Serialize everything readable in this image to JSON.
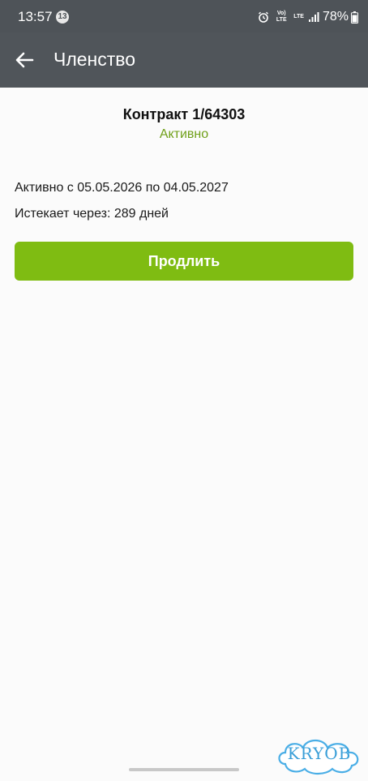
{
  "status_bar": {
    "time": "13:57",
    "notification_count": "13",
    "network_top": "Vo) LTE",
    "network_mid": "LTE",
    "battery": "78%"
  },
  "app_bar": {
    "title": "Членство",
    "back_icon": "arrow-left-icon"
  },
  "contract": {
    "title": "Контракт 1/64303",
    "status": "Активно",
    "period": "Активно с 05.05.2026 по 04.05.2027",
    "expires": "Истекает через: 289 дней"
  },
  "actions": {
    "renew_label": "Продлить"
  },
  "watermark": "KRYOB",
  "colors": {
    "app_bar": "#50555a",
    "accent": "#7fbc12",
    "status_active": "#6f9f18"
  }
}
